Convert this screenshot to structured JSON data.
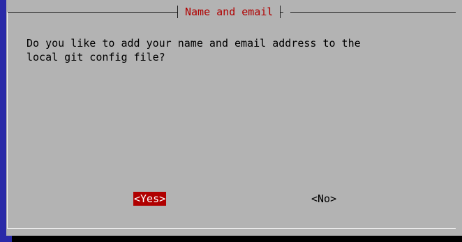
{
  "dialog": {
    "title": "Name and email",
    "message": "Do you like to add your name and email address to the\nlocal git config file?"
  },
  "buttons": {
    "yes_label": "<Yes>",
    "no_label": "<No>"
  },
  "colors": {
    "background": "#2a2aa8",
    "dialog": "#b3b3b3",
    "title": "#b00000",
    "selected_button_bg": "#b00000",
    "selected_button_text": "#ffffff"
  }
}
